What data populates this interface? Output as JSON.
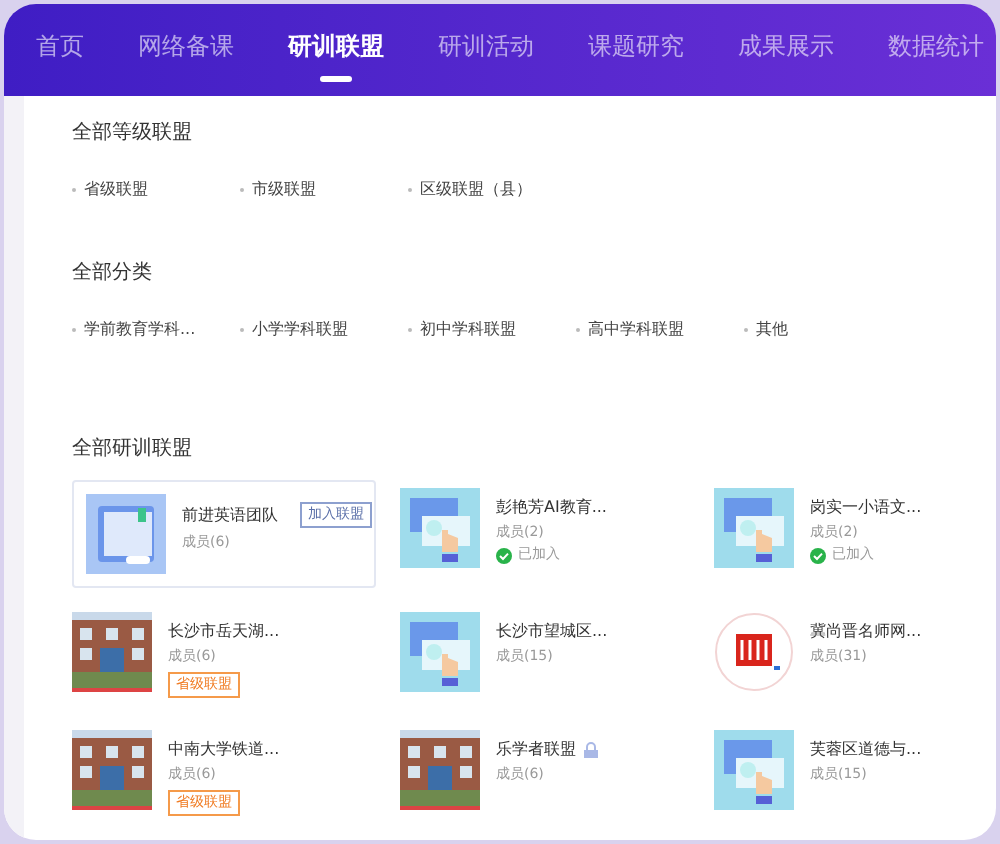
{
  "nav": [
    {
      "label": "首页",
      "selected": false
    },
    {
      "label": "网络备课",
      "selected": false
    },
    {
      "label": "研训联盟",
      "selected": true
    },
    {
      "label": "研训活动",
      "selected": false
    },
    {
      "label": "课题研究",
      "selected": false
    },
    {
      "label": "成果展示",
      "selected": false
    },
    {
      "label": "数据统计",
      "selected": false
    }
  ],
  "sections": [
    {
      "title": "全部等级联盟",
      "options": [
        "省级联盟",
        "市级联盟",
        "区级联盟（县）"
      ]
    },
    {
      "title": "全部分类",
      "options": [
        "学前教育学科...",
        "小学学科联盟",
        "初中学科联盟",
        "高中学科联盟",
        "其他"
      ]
    }
  ],
  "alliances": {
    "title": "全部研训联盟",
    "items": [
      {
        "kind": "book",
        "name": "前进英语团队",
        "members": "成员(6)",
        "selected": true,
        "action": "加入联盟"
      },
      {
        "kind": "hand",
        "name": "彭艳芳AI教育...",
        "members": "成员(2)",
        "selected": false,
        "joined": "已加入"
      },
      {
        "kind": "hand",
        "name": "岗实一小语文...",
        "members": "成员(2)",
        "selected": false,
        "joined": "已加入"
      },
      {
        "kind": "picture",
        "name": "长沙市岳天湖...",
        "members": "成员(6)",
        "selected": false,
        "badge": "省级联盟"
      },
      {
        "kind": "hand",
        "name": "长沙市望城区...",
        "members": "成员(15)",
        "selected": false
      },
      {
        "kind": "logo",
        "name": "冀尚晋名师网...",
        "members": "成员(31)",
        "selected": false
      },
      {
        "kind": "picture",
        "name": "中南大学铁道...",
        "members": "成员(6)",
        "selected": false,
        "badge": "省级联盟"
      },
      {
        "kind": "picture",
        "name": "乐学者联盟",
        "members": "成员(6)",
        "selected": false,
        "locked": true
      },
      {
        "kind": "hand",
        "name": "芙蓉区道德与...",
        "members": "成员(15)",
        "selected": false
      }
    ]
  }
}
